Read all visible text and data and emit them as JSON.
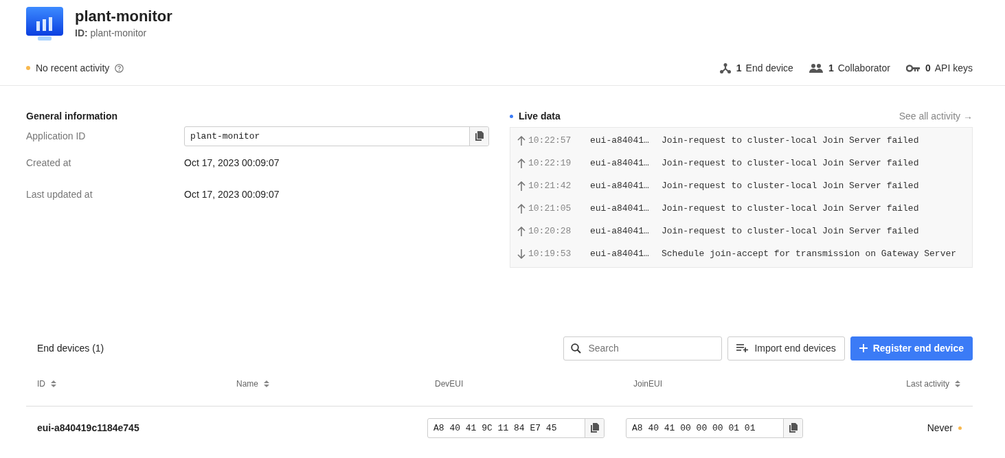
{
  "header": {
    "title": "plant-monitor",
    "id_label": "ID:",
    "id_value": "plant-monitor"
  },
  "activity": {
    "text": "No recent activity",
    "color": "#f8b84e"
  },
  "stats": [
    {
      "kind": "devices",
      "count": "1",
      "label": "End device"
    },
    {
      "kind": "collaborators",
      "count": "1",
      "label": "Collaborator"
    },
    {
      "kind": "keys",
      "count": "0",
      "label": "API keys"
    }
  ],
  "general": {
    "title": "General information",
    "rows": [
      {
        "kind": "field",
        "label": "Application ID",
        "value": "plant-monitor"
      },
      {
        "kind": "text",
        "label": "Created at",
        "value": "Oct 17, 2023 00:09:07"
      },
      {
        "kind": "text",
        "label": "Last updated at",
        "value": "Oct 17, 2023 00:09:07"
      }
    ]
  },
  "live": {
    "title": "Live data",
    "color": "#3b7bf6",
    "link": "See all activity →",
    "events": [
      {
        "kind": "uplink",
        "time": "10:22:57",
        "device": "eui-a84041…",
        "message": "Join-request to cluster-local Join Server failed"
      },
      {
        "kind": "uplink",
        "time": "10:22:19",
        "device": "eui-a84041…",
        "message": "Join-request to cluster-local Join Server failed"
      },
      {
        "kind": "uplink",
        "time": "10:21:42",
        "device": "eui-a84041…",
        "message": "Join-request to cluster-local Join Server failed"
      },
      {
        "kind": "uplink",
        "time": "10:21:05",
        "device": "eui-a84041…",
        "message": "Join-request to cluster-local Join Server failed"
      },
      {
        "kind": "uplink",
        "time": "10:20:28",
        "device": "eui-a84041…",
        "message": "Join-request to cluster-local Join Server failed"
      },
      {
        "kind": "downlink",
        "time": "10:19:53",
        "device": "eui-a84041…",
        "message": "Schedule join-accept for transmission on Gateway Server"
      }
    ]
  },
  "devices": {
    "title": "End devices (1)",
    "search_placeholder": "Search",
    "import_button": "Import end devices",
    "register_button": "Register end device",
    "columns": [
      {
        "label": "ID",
        "sortable": true
      },
      {
        "label": "Name",
        "sortable": true
      },
      {
        "label": "DevEUI",
        "sortable": false
      },
      {
        "label": "JoinEUI",
        "sortable": false
      },
      {
        "label": "Last activity",
        "sortable": true
      }
    ],
    "rows": [
      {
        "id": "eui-a840419c1184e745",
        "dev_eui": "A8 40 41 9C 11 84 E7 45",
        "join_eui": "A8 40 41 00 00 00 01 01",
        "last_activity": "Never",
        "color": "#f8b84e"
      }
    ]
  }
}
